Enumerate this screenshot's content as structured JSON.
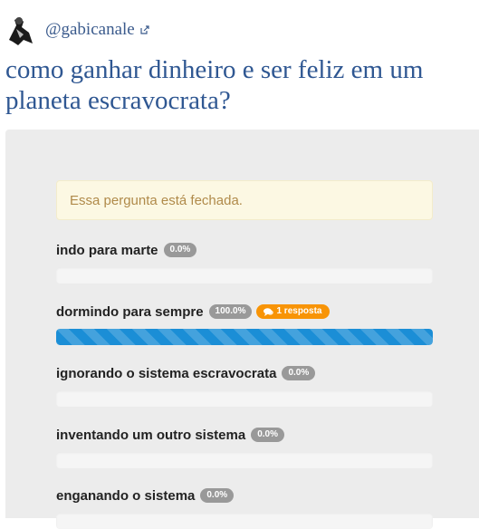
{
  "header": {
    "username": "@gabicanale"
  },
  "question": {
    "title": "como ganhar dinheiro e ser feliz em um planeta escravocrata?"
  },
  "alert": {
    "text": "Essa pergunta está fechada."
  },
  "options": [
    {
      "label": "indo para marte",
      "percent_label": "0.0%",
      "percent": 0
    },
    {
      "label": "dormindo para sempre",
      "percent_label": "100.0%",
      "percent": 100,
      "answers_label": "1 resposta"
    },
    {
      "label": "ignorando o sistema escravocrata",
      "percent_label": "0.0%",
      "percent": 0
    },
    {
      "label": "inventando um outro sistema",
      "percent_label": "0.0%",
      "percent": 0
    },
    {
      "label": "enganando o sistema",
      "percent_label": "0.0%",
      "percent": 0
    }
  ],
  "colors": {
    "accent": "#2f5792",
    "bar_fill": "#1b8ed6",
    "answers_badge": "#f89406",
    "percent_badge": "#999999"
  },
  "icons": {
    "answers": "comments-icon",
    "external": "external-link-icon"
  }
}
